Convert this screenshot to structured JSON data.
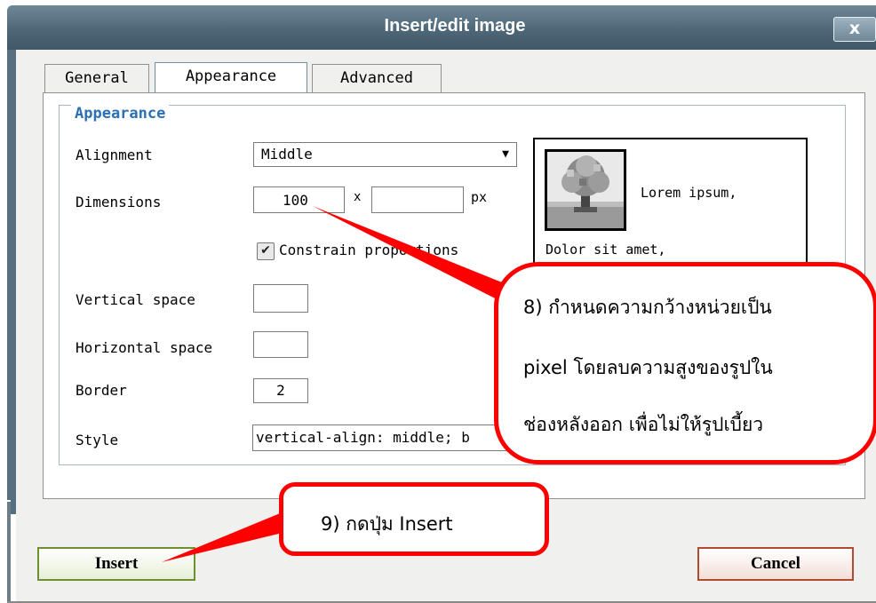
{
  "dialog": {
    "title": "Insert/edit image",
    "close_label": "x"
  },
  "tabs": [
    {
      "label": "General"
    },
    {
      "label": "Appearance"
    },
    {
      "label": "Advanced"
    }
  ],
  "appearance": {
    "legend": "Appearance",
    "alignment_label": "Alignment",
    "alignment_value": "Middle",
    "dimensions_label": "Dimensions",
    "width_value": "100",
    "times_symbol": "x",
    "height_value": "",
    "unit": "px",
    "constrain_label": "Constrain proportions",
    "constrain_checked": true,
    "vspace_label": "Vertical space",
    "vspace_value": "",
    "hspace_label": "Horizontal space",
    "hspace_value": "",
    "border_label": "Border",
    "border_value": "2",
    "style_label": "Style",
    "style_value": "vertical-align: middle; b"
  },
  "preview": {
    "line1": "Lorem ipsum,",
    "line2": "Dolor sit amet,"
  },
  "footer": {
    "insert_label": "Insert",
    "cancel_label": "Cancel"
  },
  "annotations": {
    "note8": {
      "line1": "8)  กำหนดความกว้างหน่วยเป็น",
      "line2": "pixel โดยลบความสูงของรูปใน",
      "line3": "ช่องหลังออก เพื่อไม่ให้รูปเบี้ยว"
    },
    "note9": {
      "line1": "9)  กดปุ่ม Insert"
    },
    "accent_color": "#ff0000"
  }
}
